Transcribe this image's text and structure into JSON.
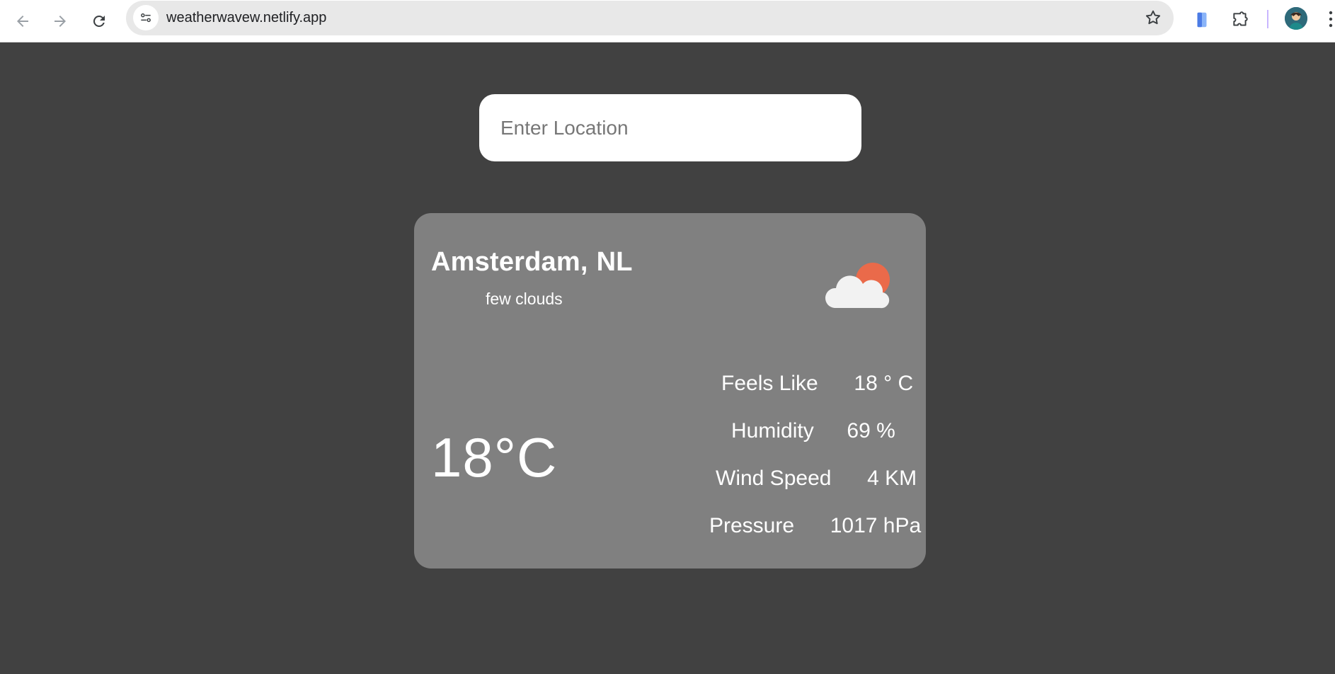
{
  "browser": {
    "url": "weatherwavew.netlify.app"
  },
  "search": {
    "placeholder": "Enter Location",
    "value": ""
  },
  "weather": {
    "city": "Amsterdam,",
    "country": "NL",
    "description": "few clouds",
    "icon": "partly-cloudy-icon",
    "temperature": "18°C",
    "stats": [
      {
        "label": "Feels Like",
        "value": "18 ° C"
      },
      {
        "label": "Humidity",
        "value": "69 %"
      },
      {
        "label": "Wind Speed",
        "value": "4 KM"
      },
      {
        "label": "Pressure",
        "value": "1017 hPa"
      }
    ]
  },
  "colors": {
    "page_bg": "#414141",
    "card_bg": "#808080",
    "sun": "#ea6a4a",
    "cloud": "#f2f2f2"
  }
}
